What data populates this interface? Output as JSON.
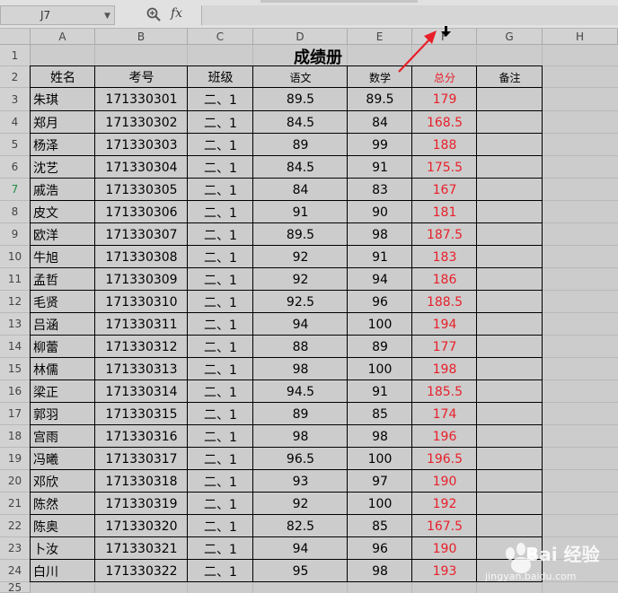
{
  "formula_bar": {
    "cell_reference": "J7",
    "zoom_icon": "magnifier-icon",
    "fx_label": "fx",
    "formula_value": ""
  },
  "columns": [
    "A",
    "B",
    "C",
    "D",
    "E",
    "F",
    "G",
    "H"
  ],
  "rows": [
    "1",
    "2",
    "3",
    "4",
    "5",
    "6",
    "7",
    "8",
    "9",
    "10",
    "11",
    "12",
    "13",
    "14",
    "15",
    "16",
    "17",
    "18",
    "19",
    "20",
    "21",
    "22",
    "23",
    "24",
    "25"
  ],
  "active_row": "7",
  "sheet": {
    "title": "成绩册",
    "headers": [
      "姓名",
      "考号",
      "班级",
      "语文",
      "数学",
      "总分",
      "备注"
    ],
    "records": [
      {
        "name": "朱琪",
        "id": "171330301",
        "class": "二、1",
        "chinese": "89.5",
        "math": "89.5",
        "total": "179"
      },
      {
        "name": "郑月",
        "id": "171330302",
        "class": "二、1",
        "chinese": "84.5",
        "math": "84",
        "total": "168.5"
      },
      {
        "name": "杨泽",
        "id": "171330303",
        "class": "二、1",
        "chinese": "89",
        "math": "99",
        "total": "188"
      },
      {
        "name": "沈艺",
        "id": "171330304",
        "class": "二、1",
        "chinese": "84.5",
        "math": "91",
        "total": "175.5"
      },
      {
        "name": "戚浩",
        "id": "171330305",
        "class": "二、1",
        "chinese": "84",
        "math": "83",
        "total": "167"
      },
      {
        "name": "皮文",
        "id": "171330306",
        "class": "二、1",
        "chinese": "91",
        "math": "90",
        "total": "181"
      },
      {
        "name": "欧洋",
        "id": "171330307",
        "class": "二、1",
        "chinese": "89.5",
        "math": "98",
        "total": "187.5"
      },
      {
        "name": "牛旭",
        "id": "171330308",
        "class": "二、1",
        "chinese": "92",
        "math": "91",
        "total": "183"
      },
      {
        "name": "孟哲",
        "id": "171330309",
        "class": "二、1",
        "chinese": "92",
        "math": "94",
        "total": "186"
      },
      {
        "name": "毛贤",
        "id": "171330310",
        "class": "二、1",
        "chinese": "92.5",
        "math": "96",
        "total": "188.5"
      },
      {
        "name": "吕涵",
        "id": "171330311",
        "class": "二、1",
        "chinese": "94",
        "math": "100",
        "total": "194"
      },
      {
        "name": "柳蕾",
        "id": "171330312",
        "class": "二、1",
        "chinese": "88",
        "math": "89",
        "total": "177"
      },
      {
        "name": "林儒",
        "id": "171330313",
        "class": "二、1",
        "chinese": "98",
        "math": "100",
        "total": "198"
      },
      {
        "name": "梁正",
        "id": "171330314",
        "class": "二、1",
        "chinese": "94.5",
        "math": "91",
        "total": "185.5"
      },
      {
        "name": "郭羽",
        "id": "171330315",
        "class": "二、1",
        "chinese": "89",
        "math": "85",
        "total": "174"
      },
      {
        "name": "宫雨",
        "id": "171330316",
        "class": "二、1",
        "chinese": "98",
        "math": "98",
        "total": "196"
      },
      {
        "name": "冯曦",
        "id": "171330317",
        "class": "二、1",
        "chinese": "96.5",
        "math": "100",
        "total": "196.5"
      },
      {
        "name": "邓欣",
        "id": "171330318",
        "class": "二、1",
        "chinese": "93",
        "math": "97",
        "total": "190"
      },
      {
        "name": "陈然",
        "id": "171330319",
        "class": "二、1",
        "chinese": "92",
        "math": "100",
        "total": "192"
      },
      {
        "name": "陈奥",
        "id": "171330320",
        "class": "二、1",
        "chinese": "82.5",
        "math": "85",
        "total": "167.5"
      },
      {
        "name": "卜汝",
        "id": "171330321",
        "class": "二、1",
        "chinese": "94",
        "math": "96",
        "total": "190"
      },
      {
        "name": "白川",
        "id": "171330322",
        "class": "二、1",
        "chinese": "95",
        "math": "98",
        "total": "193"
      }
    ],
    "total_color": "#e8202a"
  },
  "watermark": {
    "brand": "Bai 经验",
    "url": "jingyan.baidu.com"
  },
  "annotation": {
    "arrow_color": "#e8202a",
    "cursor_icon": "column-select-cursor-icon"
  }
}
